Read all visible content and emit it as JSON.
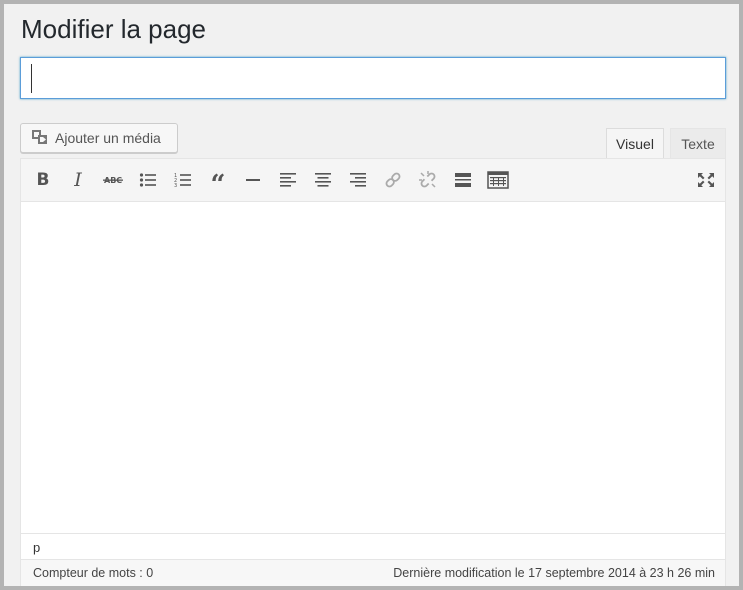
{
  "page": {
    "title": "Modifier la page"
  },
  "title_input": {
    "value": "",
    "placeholder": ""
  },
  "media_button": {
    "label": "Ajouter un média",
    "icon": "add-media-icon"
  },
  "tabs": [
    {
      "label": "Visuel",
      "active": true
    },
    {
      "label": "Texte",
      "active": false
    }
  ],
  "toolbar": {
    "buttons": [
      {
        "name": "bold",
        "icon": "bold-icon"
      },
      {
        "name": "italic",
        "icon": "italic-icon"
      },
      {
        "name": "strikethrough",
        "icon": "strikethrough-icon"
      },
      {
        "name": "bullet-list",
        "icon": "bullet-list-icon"
      },
      {
        "name": "numbered-list",
        "icon": "numbered-list-icon"
      },
      {
        "name": "blockquote",
        "icon": "quote-icon"
      },
      {
        "name": "horizontal-line",
        "icon": "horizontal-line-icon"
      },
      {
        "name": "align-left",
        "icon": "align-left-icon"
      },
      {
        "name": "align-center",
        "icon": "align-center-icon"
      },
      {
        "name": "align-right",
        "icon": "align-right-icon"
      },
      {
        "name": "insert-link",
        "icon": "link-icon"
      },
      {
        "name": "remove-link",
        "icon": "unlink-icon"
      },
      {
        "name": "read-more",
        "icon": "read-more-icon"
      },
      {
        "name": "toolbar-toggle",
        "icon": "kitchen-sink-icon"
      },
      {
        "name": "fullscreen",
        "icon": "fullscreen-icon"
      }
    ]
  },
  "path_bar": {
    "path": "p"
  },
  "status_bar": {
    "word_count": "Compteur de mots : 0",
    "last_edit": "Dernière modification le 17 septembre 2014 à 23 h 26 min"
  },
  "colors": {
    "focus_border": "#5b9dd9",
    "background": "#f1f1f1",
    "icon": "#555555"
  }
}
